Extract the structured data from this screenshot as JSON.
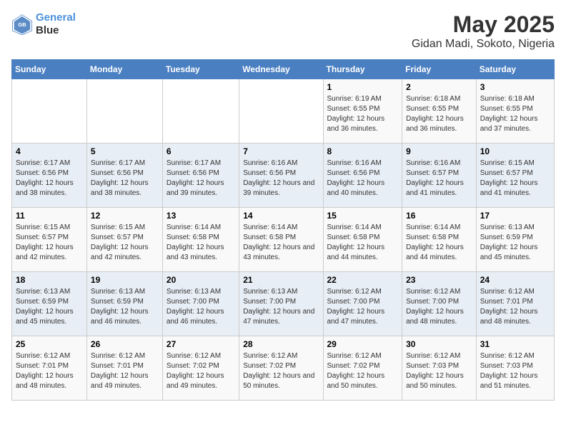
{
  "header": {
    "logo_line1": "General",
    "logo_line2": "Blue",
    "title": "May 2025",
    "subtitle": "Gidan Madi, Sokoto, Nigeria"
  },
  "weekdays": [
    "Sunday",
    "Monday",
    "Tuesday",
    "Wednesday",
    "Thursday",
    "Friday",
    "Saturday"
  ],
  "weeks": [
    [
      {
        "day": "",
        "sunrise": "",
        "sunset": "",
        "daylight": ""
      },
      {
        "day": "",
        "sunrise": "",
        "sunset": "",
        "daylight": ""
      },
      {
        "day": "",
        "sunrise": "",
        "sunset": "",
        "daylight": ""
      },
      {
        "day": "",
        "sunrise": "",
        "sunset": "",
        "daylight": ""
      },
      {
        "day": "1",
        "sunrise": "Sunrise: 6:19 AM",
        "sunset": "Sunset: 6:55 PM",
        "daylight": "Daylight: 12 hours and 36 minutes."
      },
      {
        "day": "2",
        "sunrise": "Sunrise: 6:18 AM",
        "sunset": "Sunset: 6:55 PM",
        "daylight": "Daylight: 12 hours and 36 minutes."
      },
      {
        "day": "3",
        "sunrise": "Sunrise: 6:18 AM",
        "sunset": "Sunset: 6:55 PM",
        "daylight": "Daylight: 12 hours and 37 minutes."
      }
    ],
    [
      {
        "day": "4",
        "sunrise": "Sunrise: 6:17 AM",
        "sunset": "Sunset: 6:56 PM",
        "daylight": "Daylight: 12 hours and 38 minutes."
      },
      {
        "day": "5",
        "sunrise": "Sunrise: 6:17 AM",
        "sunset": "Sunset: 6:56 PM",
        "daylight": "Daylight: 12 hours and 38 minutes."
      },
      {
        "day": "6",
        "sunrise": "Sunrise: 6:17 AM",
        "sunset": "Sunset: 6:56 PM",
        "daylight": "Daylight: 12 hours and 39 minutes."
      },
      {
        "day": "7",
        "sunrise": "Sunrise: 6:16 AM",
        "sunset": "Sunset: 6:56 PM",
        "daylight": "Daylight: 12 hours and 39 minutes."
      },
      {
        "day": "8",
        "sunrise": "Sunrise: 6:16 AM",
        "sunset": "Sunset: 6:56 PM",
        "daylight": "Daylight: 12 hours and 40 minutes."
      },
      {
        "day": "9",
        "sunrise": "Sunrise: 6:16 AM",
        "sunset": "Sunset: 6:57 PM",
        "daylight": "Daylight: 12 hours and 41 minutes."
      },
      {
        "day": "10",
        "sunrise": "Sunrise: 6:15 AM",
        "sunset": "Sunset: 6:57 PM",
        "daylight": "Daylight: 12 hours and 41 minutes."
      }
    ],
    [
      {
        "day": "11",
        "sunrise": "Sunrise: 6:15 AM",
        "sunset": "Sunset: 6:57 PM",
        "daylight": "Daylight: 12 hours and 42 minutes."
      },
      {
        "day": "12",
        "sunrise": "Sunrise: 6:15 AM",
        "sunset": "Sunset: 6:57 PM",
        "daylight": "Daylight: 12 hours and 42 minutes."
      },
      {
        "day": "13",
        "sunrise": "Sunrise: 6:14 AM",
        "sunset": "Sunset: 6:58 PM",
        "daylight": "Daylight: 12 hours and 43 minutes."
      },
      {
        "day": "14",
        "sunrise": "Sunrise: 6:14 AM",
        "sunset": "Sunset: 6:58 PM",
        "daylight": "Daylight: 12 hours and 43 minutes."
      },
      {
        "day": "15",
        "sunrise": "Sunrise: 6:14 AM",
        "sunset": "Sunset: 6:58 PM",
        "daylight": "Daylight: 12 hours and 44 minutes."
      },
      {
        "day": "16",
        "sunrise": "Sunrise: 6:14 AM",
        "sunset": "Sunset: 6:58 PM",
        "daylight": "Daylight: 12 hours and 44 minutes."
      },
      {
        "day": "17",
        "sunrise": "Sunrise: 6:13 AM",
        "sunset": "Sunset: 6:59 PM",
        "daylight": "Daylight: 12 hours and 45 minutes."
      }
    ],
    [
      {
        "day": "18",
        "sunrise": "Sunrise: 6:13 AM",
        "sunset": "Sunset: 6:59 PM",
        "daylight": "Daylight: 12 hours and 45 minutes."
      },
      {
        "day": "19",
        "sunrise": "Sunrise: 6:13 AM",
        "sunset": "Sunset: 6:59 PM",
        "daylight": "Daylight: 12 hours and 46 minutes."
      },
      {
        "day": "20",
        "sunrise": "Sunrise: 6:13 AM",
        "sunset": "Sunset: 7:00 PM",
        "daylight": "Daylight: 12 hours and 46 minutes."
      },
      {
        "day": "21",
        "sunrise": "Sunrise: 6:13 AM",
        "sunset": "Sunset: 7:00 PM",
        "daylight": "Daylight: 12 hours and 47 minutes."
      },
      {
        "day": "22",
        "sunrise": "Sunrise: 6:12 AM",
        "sunset": "Sunset: 7:00 PM",
        "daylight": "Daylight: 12 hours and 47 minutes."
      },
      {
        "day": "23",
        "sunrise": "Sunrise: 6:12 AM",
        "sunset": "Sunset: 7:00 PM",
        "daylight": "Daylight: 12 hours and 48 minutes."
      },
      {
        "day": "24",
        "sunrise": "Sunrise: 6:12 AM",
        "sunset": "Sunset: 7:01 PM",
        "daylight": "Daylight: 12 hours and 48 minutes."
      }
    ],
    [
      {
        "day": "25",
        "sunrise": "Sunrise: 6:12 AM",
        "sunset": "Sunset: 7:01 PM",
        "daylight": "Daylight: 12 hours and 48 minutes."
      },
      {
        "day": "26",
        "sunrise": "Sunrise: 6:12 AM",
        "sunset": "Sunset: 7:01 PM",
        "daylight": "Daylight: 12 hours and 49 minutes."
      },
      {
        "day": "27",
        "sunrise": "Sunrise: 6:12 AM",
        "sunset": "Sunset: 7:02 PM",
        "daylight": "Daylight: 12 hours and 49 minutes."
      },
      {
        "day": "28",
        "sunrise": "Sunrise: 6:12 AM",
        "sunset": "Sunset: 7:02 PM",
        "daylight": "Daylight: 12 hours and 50 minutes."
      },
      {
        "day": "29",
        "sunrise": "Sunrise: 6:12 AM",
        "sunset": "Sunset: 7:02 PM",
        "daylight": "Daylight: 12 hours and 50 minutes."
      },
      {
        "day": "30",
        "sunrise": "Sunrise: 6:12 AM",
        "sunset": "Sunset: 7:03 PM",
        "daylight": "Daylight: 12 hours and 50 minutes."
      },
      {
        "day": "31",
        "sunrise": "Sunrise: 6:12 AM",
        "sunset": "Sunset: 7:03 PM",
        "daylight": "Daylight: 12 hours and 51 minutes."
      }
    ]
  ]
}
